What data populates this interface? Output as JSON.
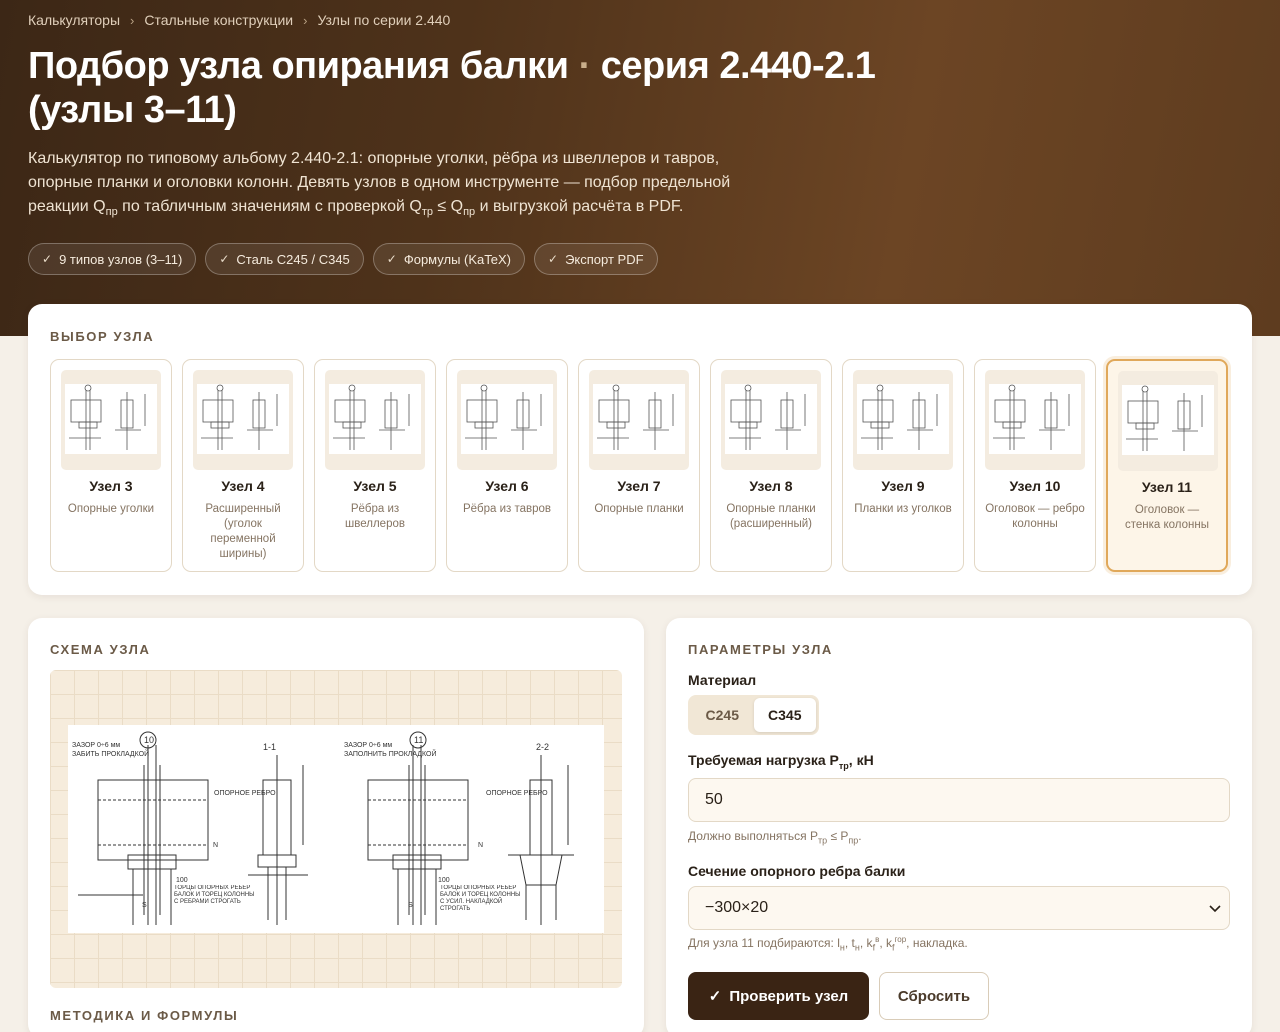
{
  "breadcrumb": [
    "Калькуляторы",
    "Стальные конструкции",
    "Узлы по серии 2.440"
  ],
  "breadcrumb_sep": "›",
  "title_part1": "Подбор узла опирания балки",
  "title_dot": "·",
  "title_part2": "серия 2.440-2.1 (узлы 3–11)",
  "lead": {
    "line1": "Калькулятор по типовому альбому 2.440-2.1: опорные уголки, рёбра из швеллеров и тавров,",
    "line2": "опорные планки и оголовки колонн. Девять узлов в одном инструменте — подбор предельной",
    "line3_a": "реакции Q",
    "sub_pr": "пр",
    "line3_b": " по табличным значениям с проверкой Q",
    "sub_tr": "тр",
    "line3_c": " ≤ Q",
    "line3_d": " и выгрузкой расчёта в PDF."
  },
  "chips": [
    "9 типов узлов (3–11)",
    "Сталь С245 / С345",
    "Формулы (KaTeX)",
    "Экспорт PDF"
  ],
  "node_select": {
    "title": "ВЫБОР УЗЛА",
    "selected_index": 8,
    "nodes": [
      {
        "title": "Узел 3",
        "desc": "Опорные уголки"
      },
      {
        "title": "Узел 4",
        "desc": "Расширенный (уголок переменной ширины)"
      },
      {
        "title": "Узел 5",
        "desc": "Рёбра из швеллеров"
      },
      {
        "title": "Узел 6",
        "desc": "Рёбра из тавров"
      },
      {
        "title": "Узел 7",
        "desc": "Опорные планки"
      },
      {
        "title": "Узел 8",
        "desc": "Опорные планки (расширенный)"
      },
      {
        "title": "Узел 9",
        "desc": "Планки из уголков"
      },
      {
        "title": "Узел 10",
        "desc": "Оголовок — ребро колонны"
      },
      {
        "title": "Узел 11",
        "desc": "Оголовок — стенка колонны"
      }
    ]
  },
  "schema": {
    "title": "СХЕМА УЗЛА",
    "left_num": "10",
    "right_num": "11",
    "left_gap": "ЗАЗОР 0÷6 мм",
    "left_fill": "ЗАБИТЬ ПРОКЛАДКОЙ",
    "right_gap": "ЗАЗОР 0÷6 мм",
    "right_fill": "ЗАПОЛНИТЬ ПРОКЛАДКОЙ",
    "sec1": "1-1",
    "sec2": "2-2",
    "rib_label": "ОПОРНОЕ РЕБРО",
    "note_left": "ТОРЦЫ ОПОРНЫХ РЕБЕР БАЛОК И ТОРЕЦ КОЛОННЫ С РЕБРАМИ СТРОГАТЬ",
    "note_right": "ТОРЦЫ ОПОРНЫХ РЕБЕР БАЛОК И ТОРЕЦ КОЛОННЫ С УСИЛ. НАКЛАДКОЙ СТРОГАТЬ",
    "dim_100": "100",
    "dim_s": "S",
    "dim_n": "N"
  },
  "method_title": "МЕТОДИКА И ФОРМУЛЫ",
  "params": {
    "title": "ПАРАМЕТРЫ УЗЛА",
    "material_label": "Материал",
    "materials": [
      "С245",
      "С345"
    ],
    "material_selected": "С345",
    "load_label": "Требуемая нагрузка P",
    "load_label_sub": "тр",
    "load_label_unit": ", кН",
    "load_value": "50",
    "load_hint_a": "Должно выполняться P",
    "load_hint_sub1": "тр",
    "load_hint_b": " ≤ P",
    "load_hint_sub2": "пр",
    "load_hint_c": ".",
    "section_label": "Сечение опорного ребра балки",
    "section_value": "−300×20",
    "section_hint": "Для узла 11 подбираются: l",
    "section_hint_rest": ", накладка.",
    "check_button": "Проверить узел",
    "reset_button": "Сбросить"
  }
}
